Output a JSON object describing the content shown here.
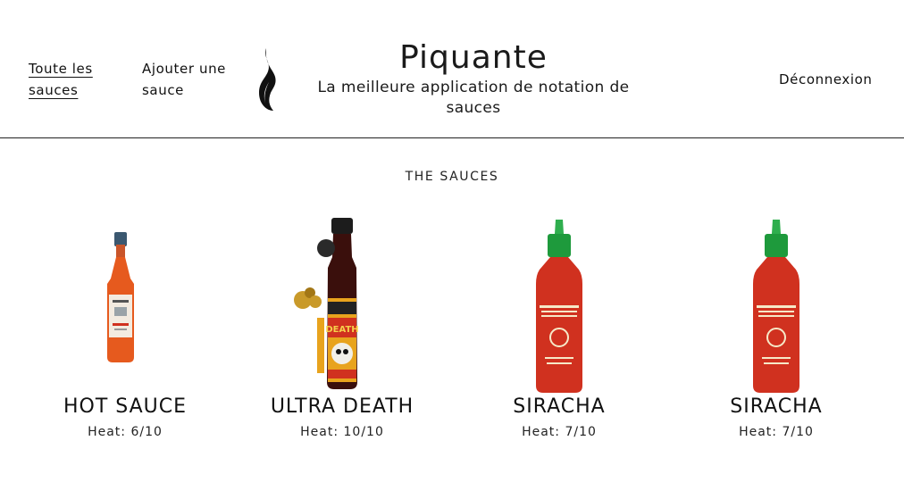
{
  "nav": {
    "all_sauces": "Toute les sauces",
    "add_sauce": "Ajouter une sauce",
    "logout": "Déconnexion"
  },
  "brand": {
    "title": "Piquante",
    "subtitle": "La meilleure application de notation de sauces",
    "logo_icon": "flame-icon"
  },
  "section_title": "THE SAUCES",
  "sauces": [
    {
      "name": "HOT SAUCE",
      "heat": "Heat: 6/10"
    },
    {
      "name": "ULTRA DEATH",
      "heat": "Heat: 10/10"
    },
    {
      "name": "SIRACHA",
      "heat": "Heat: 7/10"
    },
    {
      "name": "SIRACHA",
      "heat": "Heat: 7/10"
    }
  ],
  "colors": {
    "text": "#111111",
    "divider": "#222222",
    "sauce_red": "#d0311f",
    "cap_green": "#1e9a3c"
  }
}
